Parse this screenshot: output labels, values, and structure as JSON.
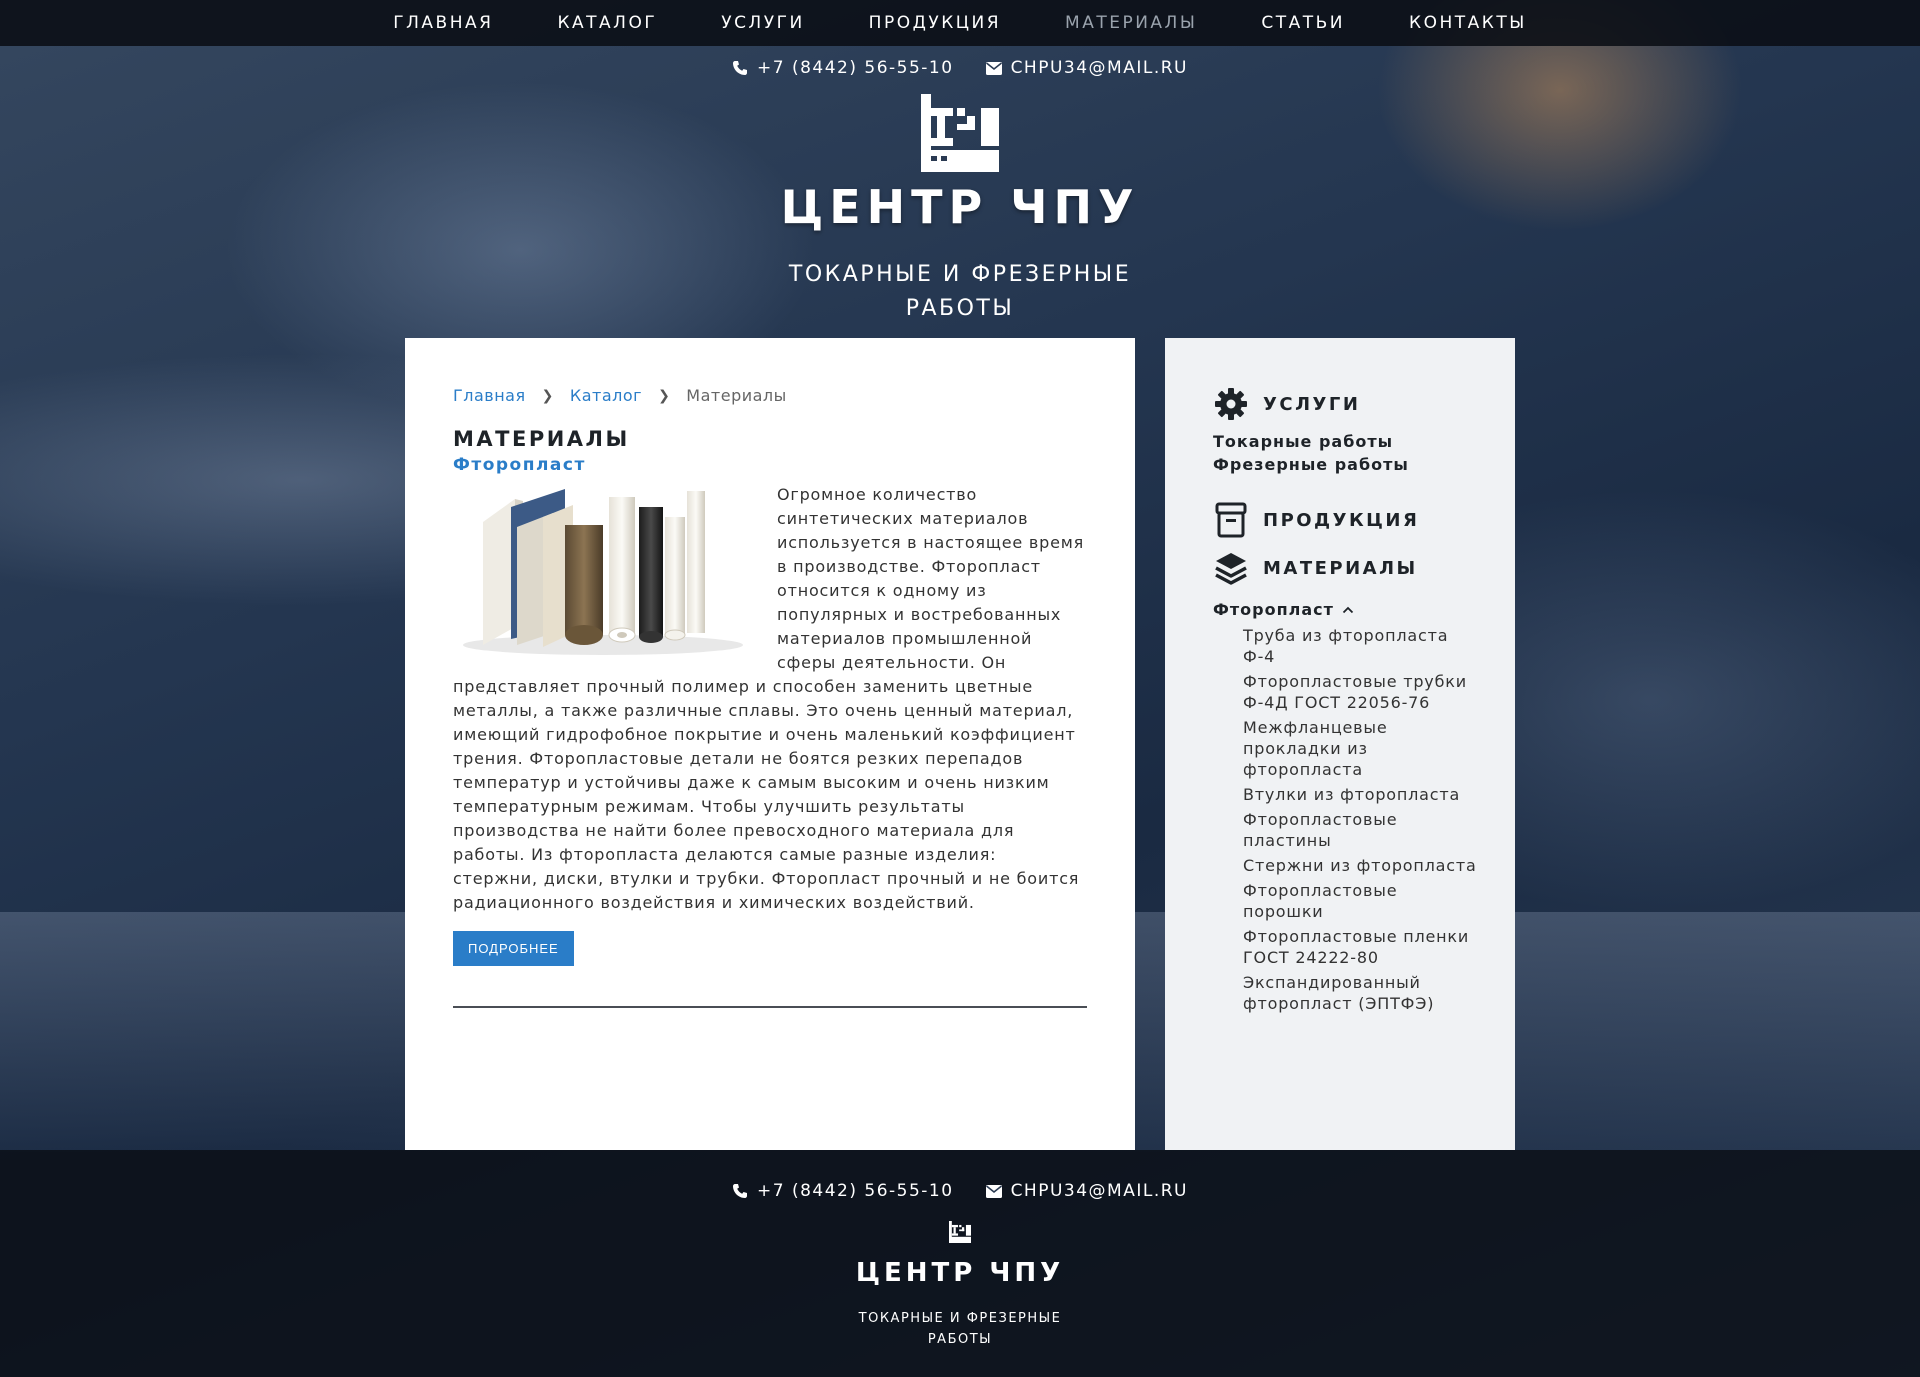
{
  "nav": {
    "items": [
      {
        "label": "ГЛАВНАЯ"
      },
      {
        "label": "КАТАЛОГ"
      },
      {
        "label": "УСЛУГИ"
      },
      {
        "label": "ПРОДУКЦИЯ"
      },
      {
        "label": "МАТЕРИАЛЫ"
      },
      {
        "label": "СТАТЬИ"
      },
      {
        "label": "КОНТАКТЫ"
      }
    ],
    "active": "МАТЕРИАЛЫ"
  },
  "header": {
    "phone": "+7 (8442) 56-55-10",
    "email": "CHPU34@MAIL.RU",
    "brand": "ЦЕНТР ЧПУ",
    "tagline_line1": "ТОКАРНЫЕ И ФРЕЗЕРНЫЕ",
    "tagline_line2": "РАБОТЫ"
  },
  "breadcrumb": {
    "home": "Главная",
    "catalog": "Каталог",
    "current": "Материалы"
  },
  "main": {
    "title": "МАТЕРИАЛЫ",
    "subtitle": "Фторопласт",
    "text": "Огромное количество синтетических материалов используется в настоящее время в производстве. Фторопласт относится к одному из популярных и востребованных материалов промышленной сферы деятельности. Он представляет прочный полимер и способен заменить цветные металлы, а также различные сплавы. Это очень ценный материал, имеющий гидрофобное покрытие и очень маленький коэффициент трения. Фторопластовые детали не боятся резких перепадов температур и устойчивы даже к самым высоким и очень низким температурным режимам. Чтобы улучшить результаты производства не найти более превосходного материала для работы. Из фторопласта делаются самые разные изделия: стержни, диски, втулки и трубки. Фторопласт прочный и не боится радиационного воздействия и химических воздействий.",
    "more_button": "ПОДРОБНЕЕ"
  },
  "sidebar": {
    "services_title": "УСЛУГИ",
    "services": [
      "Токарные работы",
      "Фрезерные работы"
    ],
    "products_title": "ПРОДУКЦИЯ",
    "materials_title": "МАТЕРИАЛЫ",
    "group_label": "Фторопласт",
    "group_items": [
      "Труба из фторопласта Ф-4",
      "Фторопластовые трубки Ф-4Д ГОСТ 22056-76",
      "Межфланцевые прокладки из фторопласта",
      "Втулки из фторопласта",
      "Фторопластовые пластины",
      "Стержни из фторопласта",
      "Фторопластовые порошки",
      "Фторопластовые пленки ГОСТ 24222-80",
      "Экспандированный фторопласт (ЭПТФЭ)"
    ]
  },
  "footer": {
    "phone": "+7 (8442) 56-55-10",
    "email": "CHPU34@MAIL.RU",
    "brand": "ЦЕНТР ЧПУ",
    "tagline_line1": "ТОКАРНЫЕ И ФРЕЗЕРНЫЕ",
    "tagline_line2": "РАБОТЫ"
  },
  "colors": {
    "accent": "#2a7dc8",
    "nav_bg": "#0a0e14",
    "sidebar_bg": "#f0f2f4"
  }
}
